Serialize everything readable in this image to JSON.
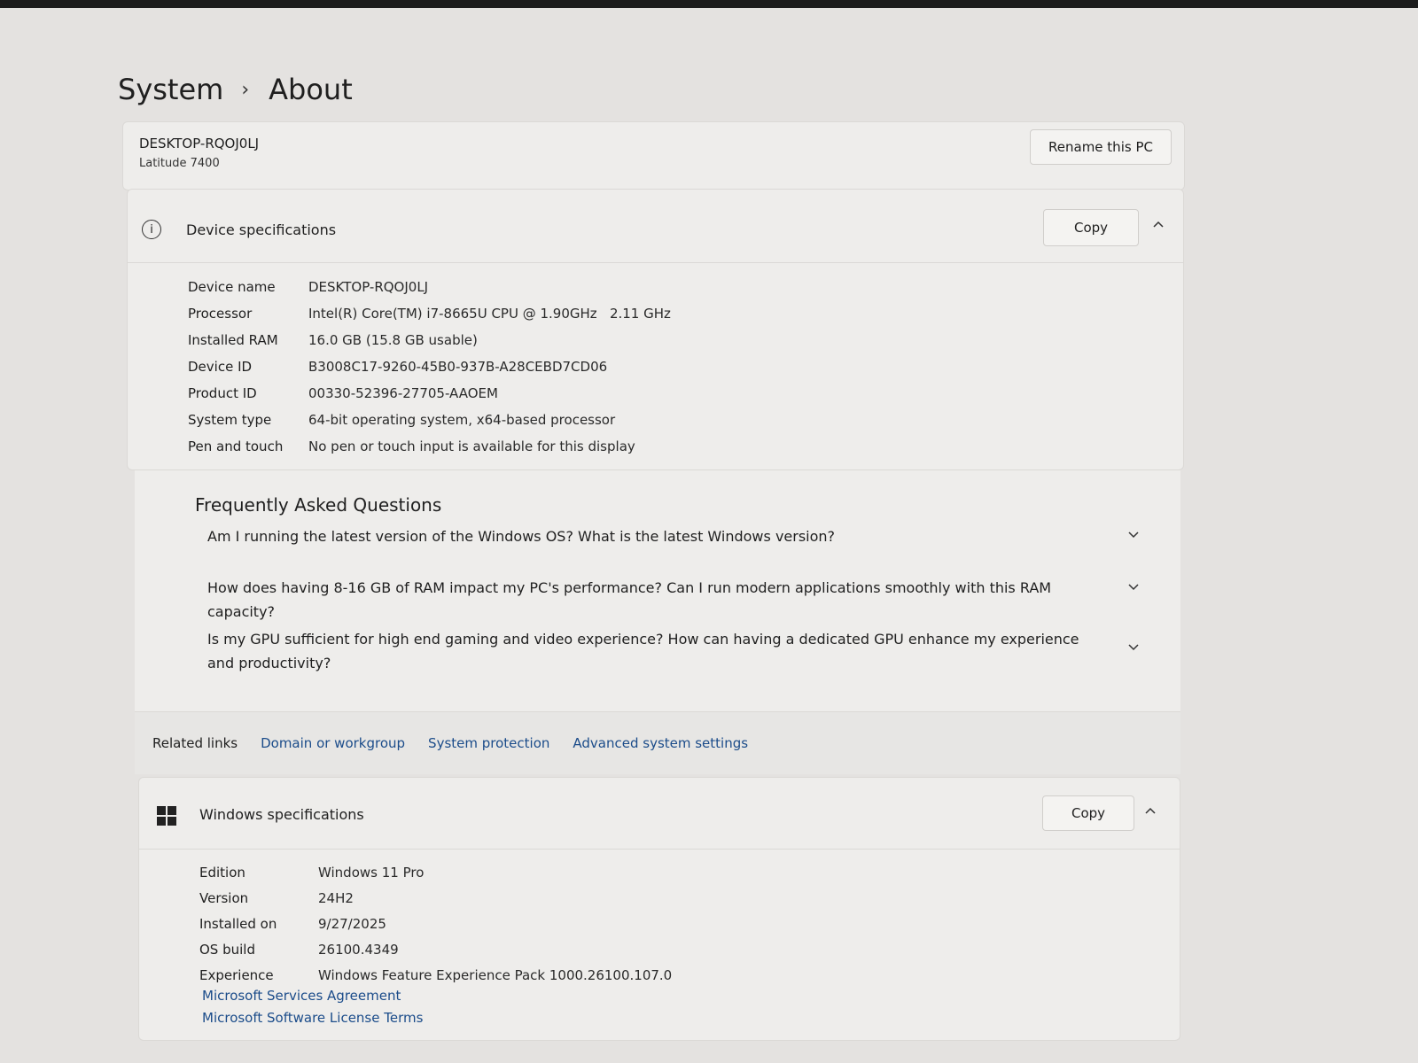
{
  "breadcrumb": {
    "parent": "System",
    "separator": "›",
    "current": "About"
  },
  "pc": {
    "name": "DESKTOP-RQOJ0LJ",
    "model": "Latitude 7400",
    "rename_label": "Rename this PC"
  },
  "device_specs": {
    "title": "Device specifications",
    "copy_label": "Copy",
    "collapse_icon": "chevron-up-icon",
    "info_glyph": "i",
    "rows": [
      {
        "label": "Device name",
        "value": "DESKTOP-RQOJ0LJ"
      },
      {
        "label": "Processor",
        "value": "Intel(R) Core(TM) i7-8665U CPU @ 1.90GHz   2.11 GHz"
      },
      {
        "label": "Installed RAM",
        "value": "16.0 GB (15.8 GB usable)"
      },
      {
        "label": "Device ID",
        "value": "B3008C17-9260-45B0-937B-A28CEBD7CD06"
      },
      {
        "label": "Product ID",
        "value": "00330-52396-27705-AAOEM"
      },
      {
        "label": "System type",
        "value": "64-bit operating system, x64-based processor"
      },
      {
        "label": "Pen and touch",
        "value": "No pen or touch input is available for this display"
      }
    ]
  },
  "faq": {
    "title": "Frequently Asked Questions",
    "expand_icon": "chevron-down-icon",
    "questions": [
      "Am I running the latest version of the Windows OS? What is the latest Windows version?",
      "How does having 8-16 GB of RAM impact my PC's performance? Can I run modern applications smoothly with this RAM capacity?",
      "Is my GPU sufficient for high end gaming and video experience? How can having a dedicated GPU enhance my experience and productivity?"
    ]
  },
  "related_links": {
    "label": "Related links",
    "links": [
      "Domain or workgroup",
      "System protection",
      "Advanced system settings"
    ]
  },
  "windows_specs": {
    "title": "Windows specifications",
    "copy_label": "Copy",
    "rows": [
      {
        "label": "Edition",
        "value": "Windows 11 Pro"
      },
      {
        "label": "Version",
        "value": "24H2"
      },
      {
        "label": "Installed on",
        "value": "9/27/2025"
      },
      {
        "label": "OS build",
        "value": "26100.4349"
      },
      {
        "label": "Experience",
        "value": "Windows Feature Experience Pack 1000.26100.107.0"
      }
    ],
    "links": [
      "Microsoft Services Agreement",
      "Microsoft Software License Terms"
    ]
  },
  "colors": {
    "accent_link": "#1b4c8a",
    "background": "#e4e2e0",
    "card": "#eeedeb"
  }
}
